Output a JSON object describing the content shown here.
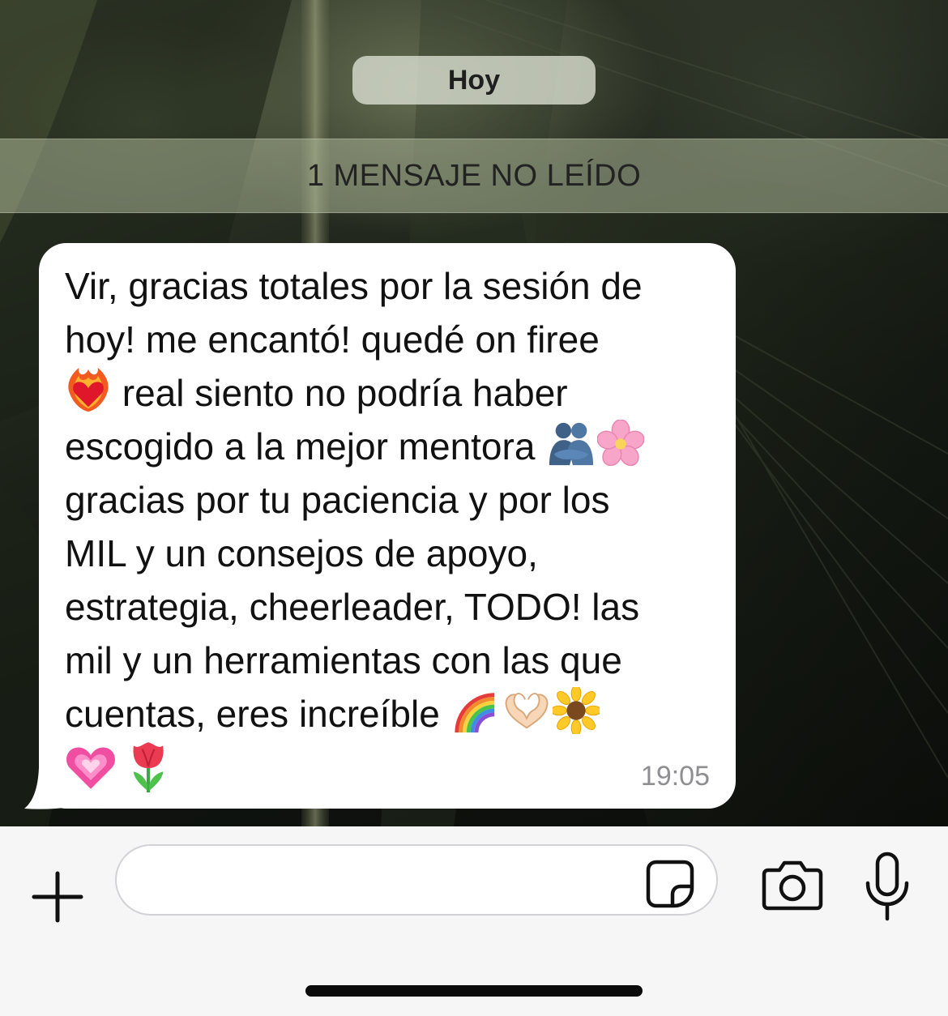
{
  "date_chip": {
    "label": "Hoy"
  },
  "unread_banner": {
    "label": "1 MENSAJE NO LEÍDO"
  },
  "message": {
    "lines": [
      "Vir, gracias totales por la sesión de",
      "hoy! me encantó! quedé on firee",
      " real siento no podría haber",
      "escogido a la mejor mentora ",
      "gracias por tu paciencia y por los",
      "MIL y un consejos de apoyo,",
      "estrategia, cheerleader, TODO! las",
      "mil y un herramientas con las que",
      "cuentas, eres increíble "
    ],
    "emojis": {
      "heart_on_fire": "heart-on-fire-emoji",
      "people_hugging": "people-hugging-emoji",
      "cherry_blossom": "cherry-blossom-emoji",
      "rainbow": "rainbow-emoji",
      "heart_hands": "heart-hands-emoji",
      "sunflower": "sunflower-emoji",
      "growing_heart": "growing-heart-emoji",
      "tulip": "tulip-emoji"
    },
    "time": "19:05"
  },
  "composer": {
    "input_value": "",
    "icons": {
      "attach": "plus-icon",
      "sticker": "sticker-icon",
      "camera": "camera-icon",
      "mic": "microphone-icon"
    }
  },
  "colors": {
    "bubble": "#ffffff",
    "time": "#8e8e93",
    "composer_bg": "#f6f6f6"
  }
}
